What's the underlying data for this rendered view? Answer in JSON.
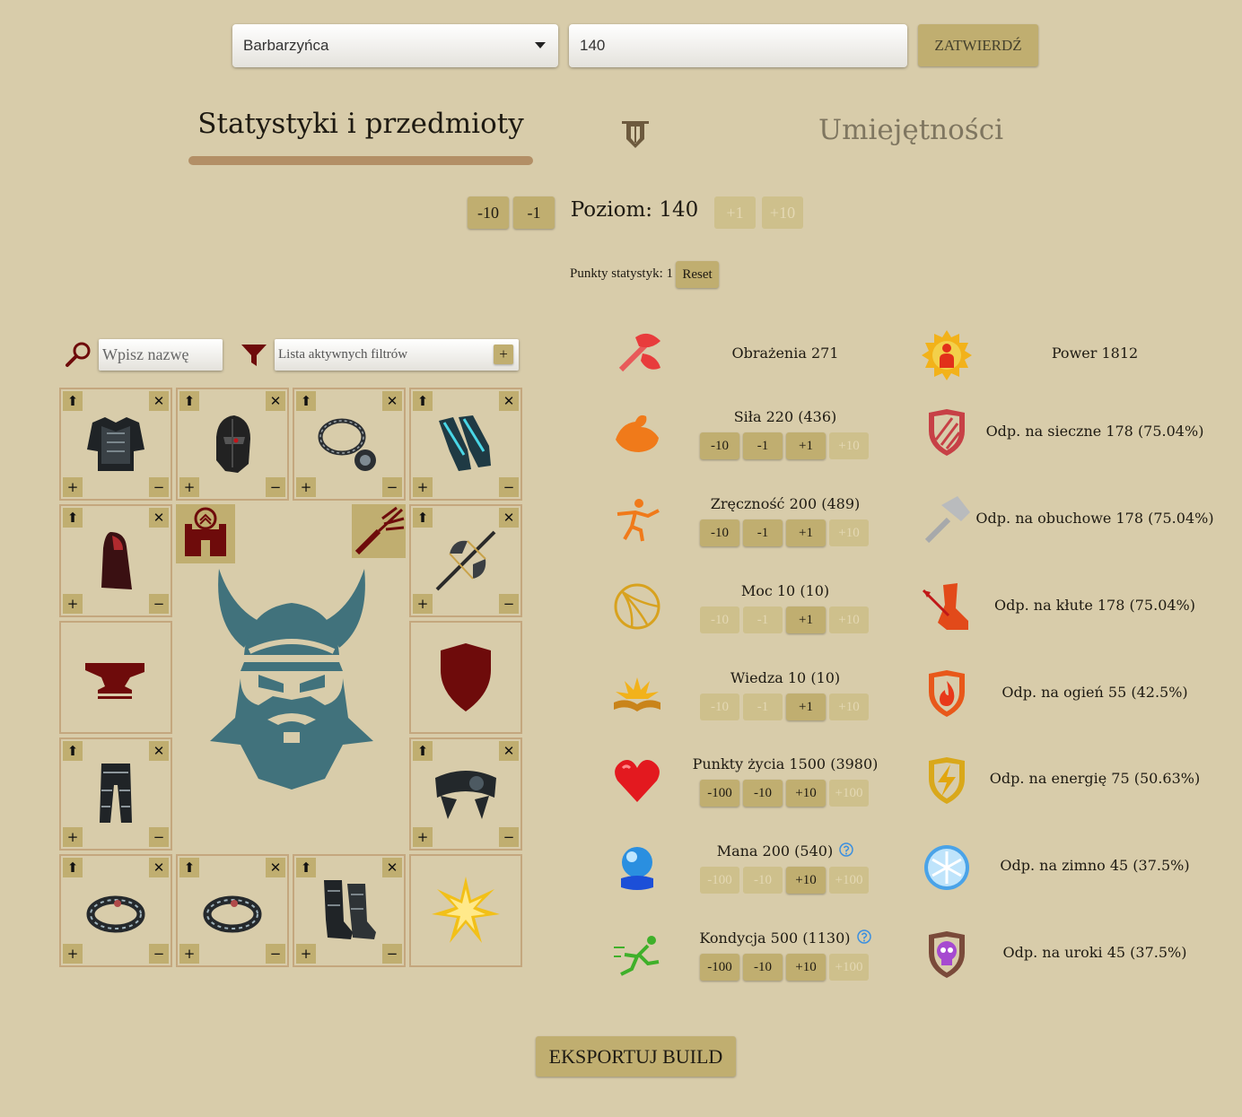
{
  "top": {
    "class_select": "Barbarzyńca",
    "level_input": "140",
    "confirm_label": "ZATWIERDŹ"
  },
  "tabs": {
    "active": "Statystyki i przedmioty",
    "inactive": "Umiejętności"
  },
  "level": {
    "minus10": "-10",
    "minus1": "-1",
    "label": "Poziom: 140",
    "plus1": "+1",
    "plus10": "+10"
  },
  "stat_points": {
    "label": "Punkty statystyk: 1",
    "reset": "Reset"
  },
  "inventory": {
    "search_placeholder": "Wpisz nazwę",
    "filters_placeholder": "Lista aktywnych filtrów",
    "filters_add": "+"
  },
  "stats": [
    {
      "name": "Obrażenia 271",
      "buttons": []
    },
    {
      "name": "Siła 220 (436)",
      "buttons": [
        "-10",
        "-1",
        "+1",
        "+10"
      ]
    },
    {
      "name": "Zręczność 200 (489)",
      "buttons": [
        "-10",
        "-1",
        "+1",
        "+10"
      ]
    },
    {
      "name": "Moc 10 (10)",
      "buttons": [
        "-10",
        "-1",
        "+1",
        "+10"
      ]
    },
    {
      "name": "Wiedza 10 (10)",
      "buttons": [
        "-10",
        "-1",
        "+1",
        "+10"
      ]
    },
    {
      "name": "Punkty życia 1500 (3980)",
      "buttons": [
        "-100",
        "-10",
        "+10",
        "+100"
      ]
    },
    {
      "name": "Mana 200 (540)",
      "buttons": [
        "-100",
        "-10",
        "+10",
        "+100"
      ]
    },
    {
      "name": "Kondycja 500 (1130)",
      "buttons": [
        "-100",
        "-10",
        "+10",
        "+100"
      ]
    }
  ],
  "resistances": [
    "Power 1812",
    "Odp. na sieczne 178 (75.04%)",
    "Odp. na obuchowe 178 (75.04%)",
    "Odp. na kłute 178 (75.04%)",
    "Odp. na ogień 55 (42.5%)",
    "Odp. na energię 75 (50.63%)",
    "Odp. na zimno 45 (37.5%)",
    "Odp. na uroki 45 (37.5%)"
  ],
  "export_label": "EKSPORTUJ BUILD",
  "colors": {
    "background": "#d8ccaa",
    "button": "#c0ae70",
    "slot_border": "#c4a77e",
    "dark_red": "#6e0b0b",
    "viking": "#41727c"
  }
}
